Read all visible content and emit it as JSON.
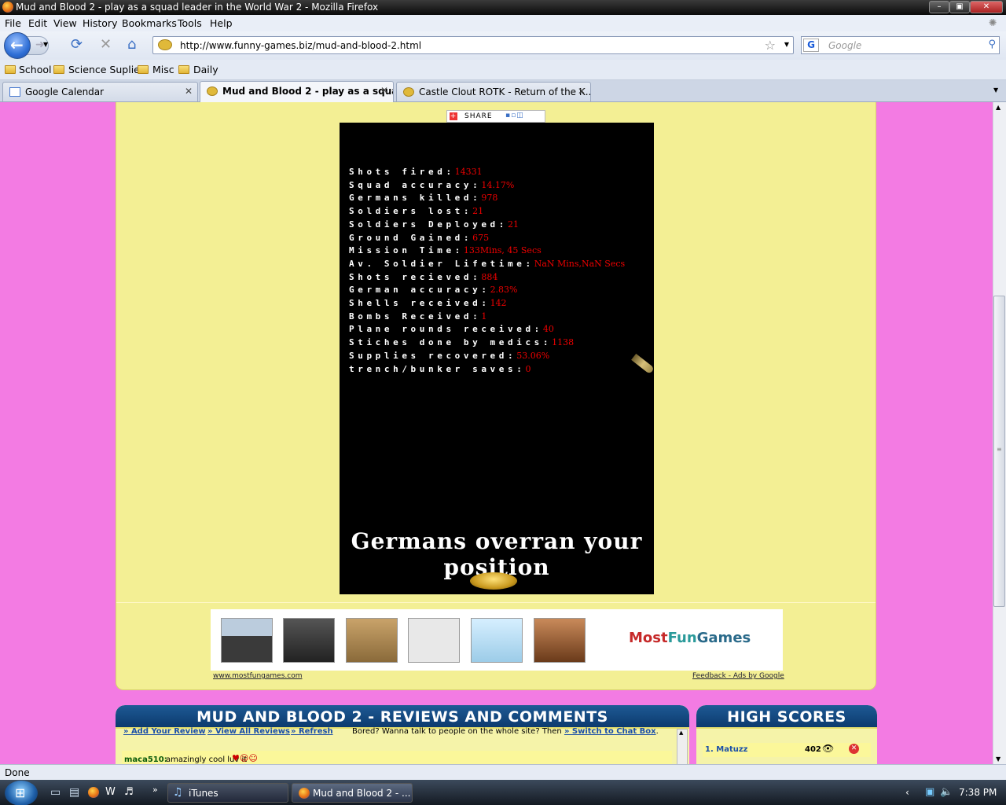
{
  "window": {
    "title": "Mud and Blood 2 - play as a squad leader in the World War 2 - Mozilla Firefox"
  },
  "menu": [
    "File",
    "Edit",
    "View",
    "History",
    "Bookmarks",
    "Tools",
    "Help"
  ],
  "nav": {
    "url": "http://www.funny-games.biz/mud-and-blood-2.html",
    "search_placeholder": "Google"
  },
  "bookmarks": [
    "School",
    "Science Suplies",
    "Misc",
    "Daily"
  ],
  "tabs": [
    {
      "label": "Google Calendar"
    },
    {
      "label": "Mud and Blood 2 - play as a squad ...",
      "active": true
    },
    {
      "label": "Castle Clout ROTK - Return of the K..."
    }
  ],
  "share": {
    "label": "SHARE"
  },
  "game": {
    "stats": [
      {
        "label": "Shots fired:",
        "value": "14331"
      },
      {
        "label": "Squad accuracy:",
        "value": "14.17%"
      },
      {
        "label": "Germans killed:",
        "value": "978"
      },
      {
        "label": "Soldiers lost:",
        "value": "21"
      },
      {
        "label": "Soldiers Deployed:",
        "value": "21"
      },
      {
        "label": "Ground Gained:",
        "value": "675"
      },
      {
        "label": "Mission Time:",
        "value": "133Mins, 45 Secs"
      },
      {
        "label": "Av. Soldier Lifetime:",
        "value": "NaN Mins,NaN Secs"
      },
      {
        "label": "Shots recieved:",
        "value": "884"
      },
      {
        "label": "German accuracy:",
        "value": "2.83%"
      },
      {
        "label": "Shells received:",
        "value": "142"
      },
      {
        "label": "Bombs Received:",
        "value": "1"
      },
      {
        "label": "Plane rounds received:",
        "value": "40"
      },
      {
        "label": "Stiches done by medics:",
        "value": "1138"
      },
      {
        "label": "Supplies recovered:",
        "value": "53.06%"
      },
      {
        "label": "trench/bunker saves:",
        "value": "0"
      }
    ],
    "gameover_text": "Germans overran your position"
  },
  "ads": {
    "logo_part1": "Most",
    "logo_part2": "Fun",
    "logo_part3": "Games",
    "left_link": "www.mostfungames.com",
    "right_link": "Feedback - Ads by Google"
  },
  "reviews": {
    "title": "MUD AND BLOOD 2 - REVIEWS AND COMMENTS",
    "add": "» Add Your Review",
    "view": "» View All Reviews",
    "refresh": "» Refresh",
    "chat_text": "Bored? Wanna talk to people on the whole site? Then",
    "chat_link": "» Switch to Chat Box",
    "chat_end": ".",
    "first_user": "maca510:",
    "first_comment": "amazingly cool luv it"
  },
  "scores": {
    "title": "HIGH SCORES",
    "rows": [
      {
        "name": "1. Matuzz",
        "score": "402"
      }
    ]
  },
  "status": {
    "text": "Done"
  },
  "taskbar": {
    "buttons": [
      {
        "label": "iTunes"
      },
      {
        "label": "Mud and Blood 2 - ..."
      }
    ],
    "clock": "7:38 PM"
  }
}
